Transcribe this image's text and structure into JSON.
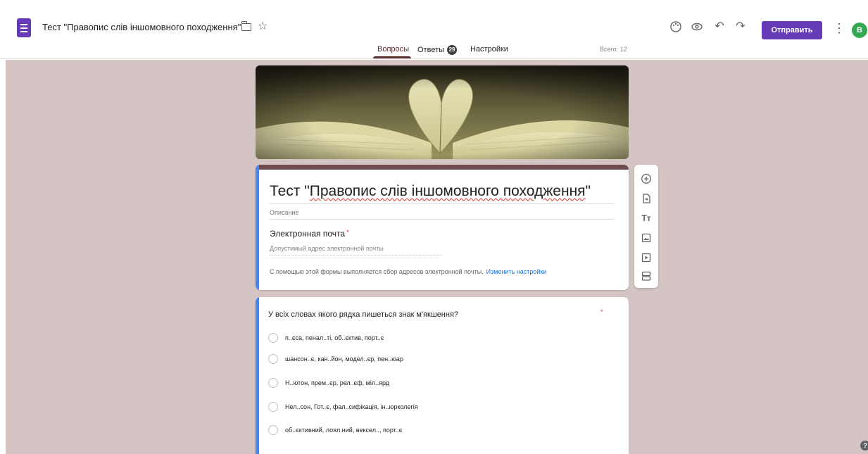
{
  "header": {
    "doc_title": "Тест \"Правопис слів іншомовного походження\"",
    "send_label": "Отправить",
    "avatar_letter": "B"
  },
  "tabs": {
    "questions": "Вопросы",
    "answers": "Ответы",
    "answers_count": "29",
    "settings": "Настройки",
    "total": "Всего: 12"
  },
  "form": {
    "title_prefix": "Тест \"",
    "title_underlined": "Правопис слів іншомовного походження",
    "title_suffix": "\"",
    "description_placeholder": "Описание",
    "email_label": "Электронная почта",
    "required_mark": "*",
    "email_placeholder": "Допустимый адрес электронной почты",
    "email_note": "С помощью этой формы выполняется сбор адресов электронной почты.",
    "email_note_link": "Изменить настройки"
  },
  "question": {
    "title": "У всіх словах якого рядка пишеться знак м'якшення?",
    "required_mark": "*",
    "options": [
      "п..єса, пенал..ті, об..єктив, порт..є",
      "шансон..є, кан..йон, модел..єр, пен..юар",
      "Н..ютон, прем..єр, рел..єф, міл..ярд",
      "Нел..сон, Гот..є, фал..сифікація, ін..юрколегія",
      "об..єктивний, лоял.ний, вексел.., порт..є"
    ]
  },
  "colors": {
    "accent": "#673ab7",
    "theme": "#6e4c4c",
    "background": "#d5c4c4",
    "focus_band": "#4285f4"
  }
}
